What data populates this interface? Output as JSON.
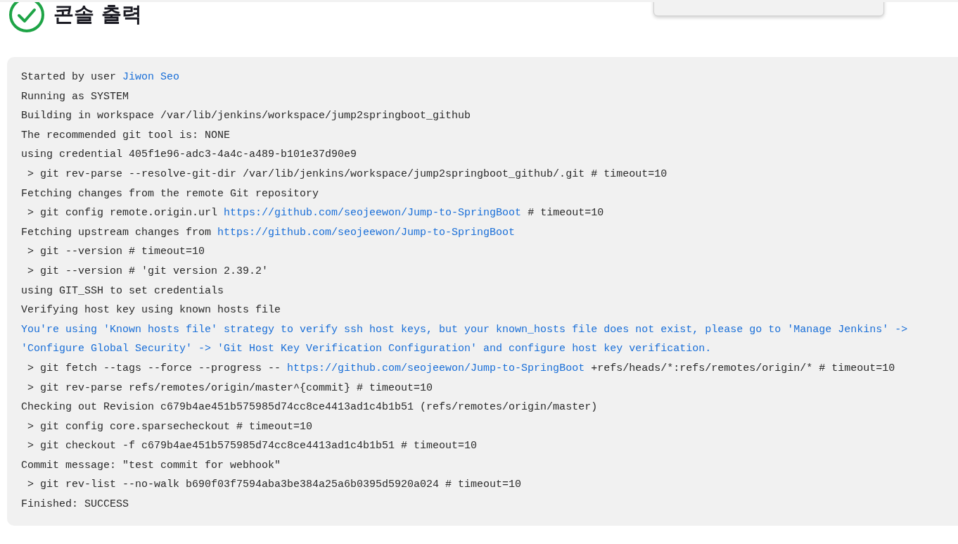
{
  "page": {
    "title": "콘솔 출력",
    "succeeded": true
  },
  "console": {
    "lines": [
      {
        "kind": "plain",
        "segments": [
          {
            "kind": "text",
            "text": "Started by user "
          },
          {
            "kind": "link",
            "text": "Jiwon Seo"
          }
        ]
      },
      {
        "kind": "plain",
        "segments": [
          {
            "kind": "text",
            "text": "Running as SYSTEM"
          }
        ]
      },
      {
        "kind": "plain",
        "segments": [
          {
            "kind": "text",
            "text": "Building in workspace /var/lib/jenkins/workspace/jump2springboot_github"
          }
        ]
      },
      {
        "kind": "plain",
        "segments": [
          {
            "kind": "text",
            "text": "The recommended git tool is: NONE"
          }
        ]
      },
      {
        "kind": "plain",
        "segments": [
          {
            "kind": "text",
            "text": "using credential 405f1e96-adc3-4a4c-a489-b101e37d90e9"
          }
        ]
      },
      {
        "kind": "plain",
        "segments": [
          {
            "kind": "text",
            "text": " > git rev-parse --resolve-git-dir /var/lib/jenkins/workspace/jump2springboot_github/.git # timeout=10"
          }
        ]
      },
      {
        "kind": "plain",
        "segments": [
          {
            "kind": "text",
            "text": "Fetching changes from the remote Git repository"
          }
        ]
      },
      {
        "kind": "plain",
        "segments": [
          {
            "kind": "text",
            "text": " > git config remote.origin.url "
          },
          {
            "kind": "link",
            "text": "https://github.com/seojeewon/Jump-to-SpringBoot"
          },
          {
            "kind": "text",
            "text": " # timeout=10"
          }
        ]
      },
      {
        "kind": "plain",
        "segments": [
          {
            "kind": "text",
            "text": "Fetching upstream changes from "
          },
          {
            "kind": "link",
            "text": "https://github.com/seojeewon/Jump-to-SpringBoot"
          }
        ]
      },
      {
        "kind": "plain",
        "segments": [
          {
            "kind": "text",
            "text": " > git --version # timeout=10"
          }
        ]
      },
      {
        "kind": "plain",
        "segments": [
          {
            "kind": "text",
            "text": " > git --version # 'git version 2.39.2'"
          }
        ]
      },
      {
        "kind": "plain",
        "segments": [
          {
            "kind": "text",
            "text": "using GIT_SSH to set credentials"
          }
        ]
      },
      {
        "kind": "plain",
        "segments": [
          {
            "kind": "text",
            "text": "Verifying host key using known hosts file"
          }
        ]
      },
      {
        "kind": "warning",
        "segments": [
          {
            "kind": "text",
            "text": "You're using 'Known hosts file' strategy to verify ssh host keys, but your known_hosts file does not exist, please go to 'Manage Jenkins' ->"
          }
        ]
      },
      {
        "kind": "warning",
        "segments": [
          {
            "kind": "text",
            "text": "'Configure Global Security' -> 'Git Host Key Verification Configuration' and configure host key verification."
          }
        ]
      },
      {
        "kind": "plain",
        "segments": [
          {
            "kind": "text",
            "text": " > git fetch --tags --force --progress -- "
          },
          {
            "kind": "link",
            "text": "https://github.com/seojeewon/Jump-to-SpringBoot"
          },
          {
            "kind": "text",
            "text": " +refs/heads/*:refs/remotes/origin/* # timeout=10"
          }
        ]
      },
      {
        "kind": "plain",
        "segments": [
          {
            "kind": "text",
            "text": " > git rev-parse refs/remotes/origin/master^{commit} # timeout=10"
          }
        ]
      },
      {
        "kind": "plain",
        "segments": [
          {
            "kind": "text",
            "text": "Checking out Revision c679b4ae451b575985d74cc8ce4413ad1c4b1b51 (refs/remotes/origin/master)"
          }
        ]
      },
      {
        "kind": "plain",
        "segments": [
          {
            "kind": "text",
            "text": " > git config core.sparsecheckout # timeout=10"
          }
        ]
      },
      {
        "kind": "plain",
        "segments": [
          {
            "kind": "text",
            "text": " > git checkout -f c679b4ae451b575985d74cc8ce4413ad1c4b1b51 # timeout=10"
          }
        ]
      },
      {
        "kind": "plain",
        "segments": [
          {
            "kind": "text",
            "text": "Commit message: \"test commit for webhook\""
          }
        ]
      },
      {
        "kind": "plain",
        "segments": [
          {
            "kind": "text",
            "text": " > git rev-list --no-walk b690f03f7594aba3be384a25a6b0395d5920a024 # timeout=10"
          }
        ]
      },
      {
        "kind": "plain",
        "segments": [
          {
            "kind": "text",
            "text": "Finished: SUCCESS"
          }
        ]
      }
    ]
  }
}
